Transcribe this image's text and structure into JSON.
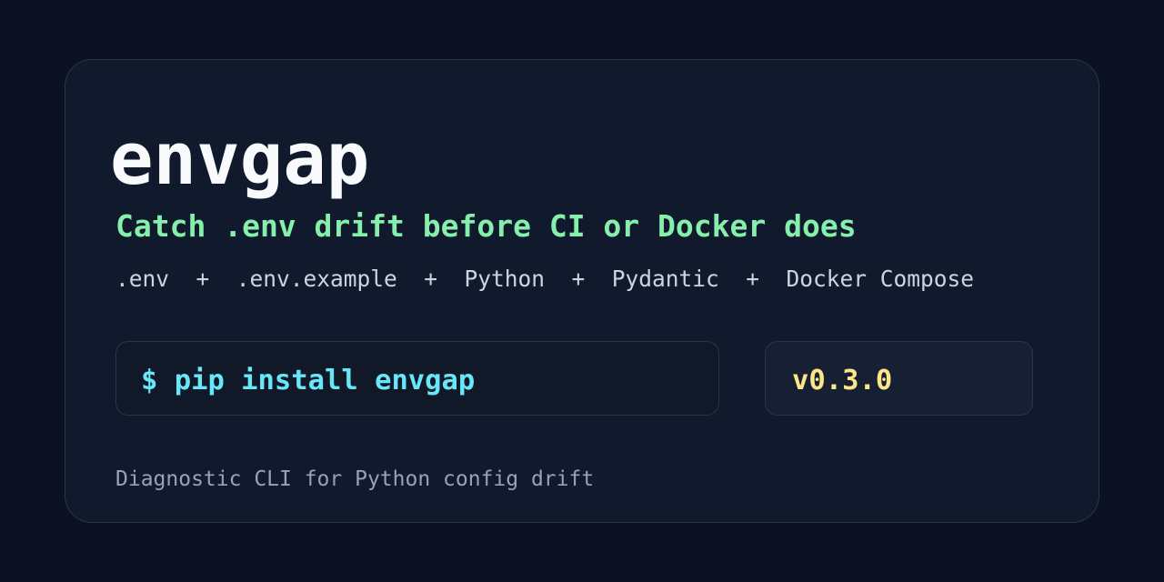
{
  "card": {
    "title": "envgap",
    "tagline": "Catch .env drift before CI or Docker does",
    "stack": ".env  +  .env.example  +  Python  +  Pydantic  +  Docker Compose",
    "install_command": "$ pip install envgap",
    "version": "v0.3.0",
    "description": "Diagnostic CLI for Python config drift"
  },
  "colors": {
    "background": "#0b1120",
    "card": "#101a2c",
    "title": "#f8fafc",
    "tagline": "#86efac",
    "command": "#67e8f9",
    "version": "#fde68a",
    "muted": "#94a3b8"
  }
}
